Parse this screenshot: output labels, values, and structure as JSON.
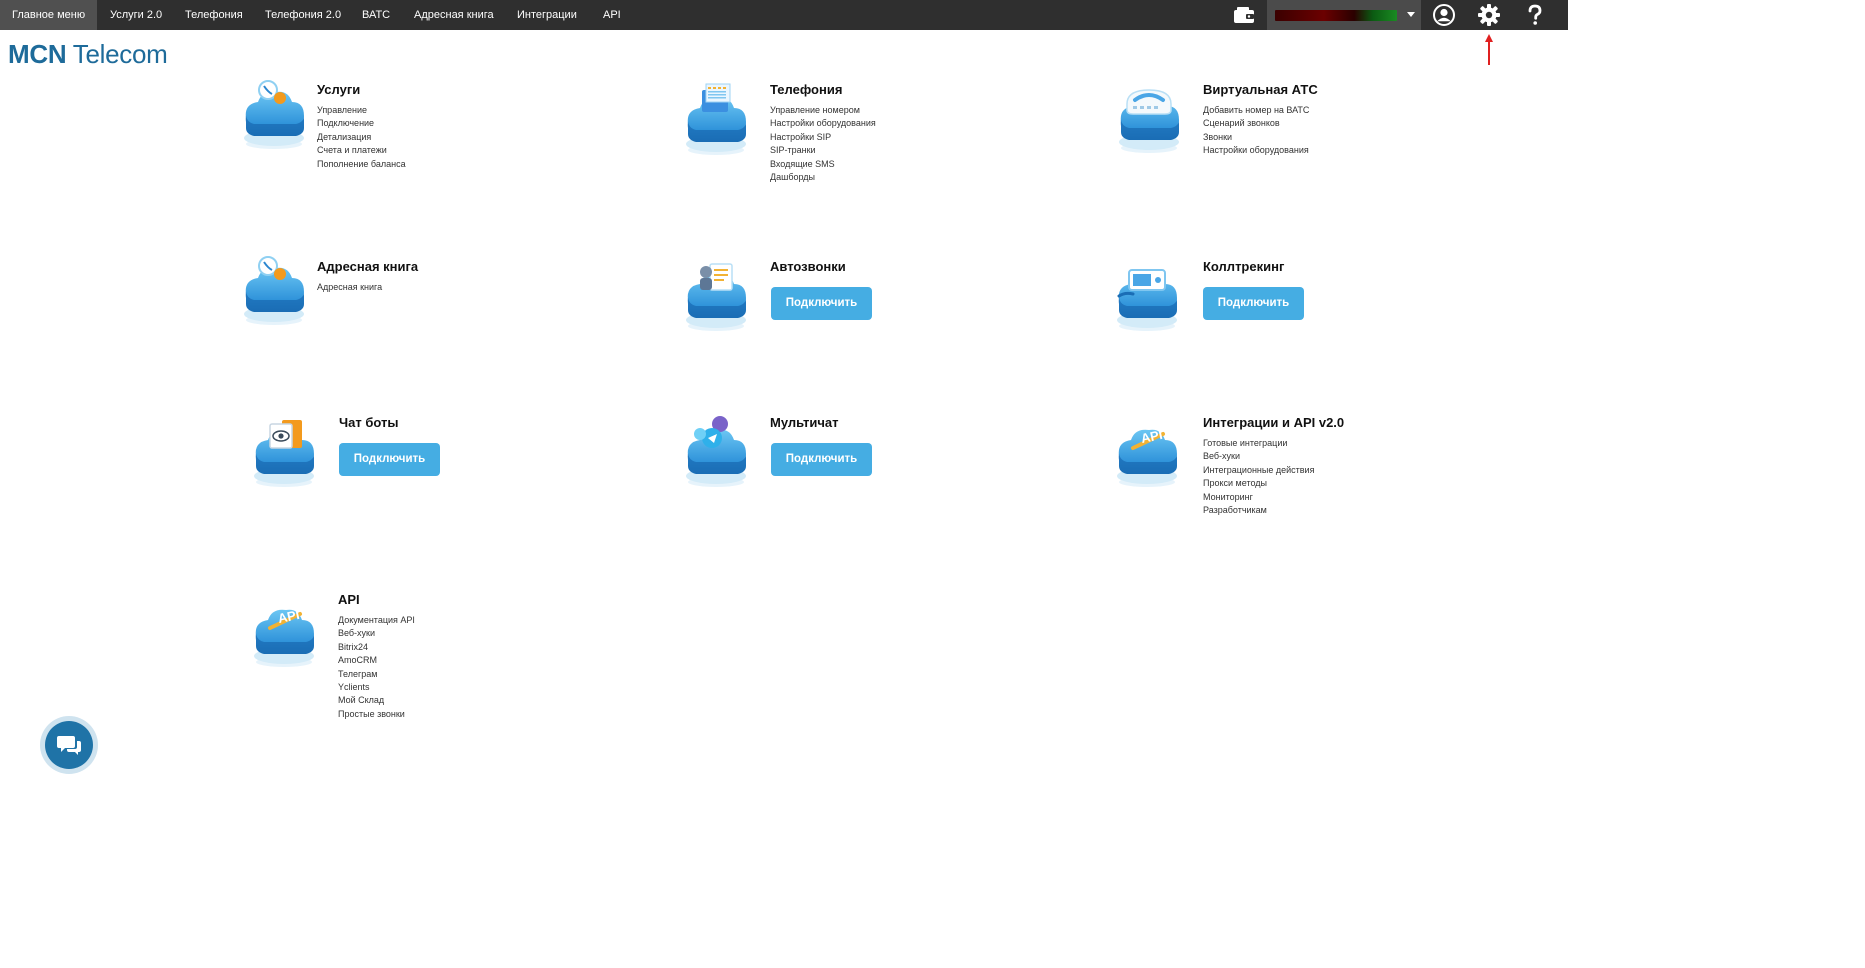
{
  "nav": {
    "items": [
      {
        "label": "Главное меню",
        "active": true
      },
      {
        "label": "Услуги 2.0"
      },
      {
        "label": "Телефония"
      },
      {
        "label": "Телефония 2.0"
      },
      {
        "label": "ВАТС"
      },
      {
        "label": "Адресная книга"
      },
      {
        "label": "Интеграции"
      },
      {
        "label": "API"
      }
    ],
    "icons": [
      "wallet-icon",
      "user-circle-icon",
      "gear-icon",
      "help-icon"
    ]
  },
  "logo": {
    "bold": "MCN",
    "rest": " Telecom"
  },
  "cards": {
    "uslugi": {
      "title": "Услуги",
      "links": [
        "Управление",
        "Подключение",
        "Детализация",
        "Счета и платежи",
        "Пополнение баланса"
      ]
    },
    "telefoniya": {
      "title": "Телефония",
      "links": [
        "Управление номером",
        "Настройки оборудования",
        "Настройки SIP",
        "SIP-транки",
        "Входящие SMS",
        "Дашборды"
      ]
    },
    "vats": {
      "title": "Виртуальная АТС",
      "links": [
        "Добавить номер на ВАТС",
        "Сценарий звонков",
        "Звонки",
        "Настройки оборудования"
      ]
    },
    "adresnaya": {
      "title": "Адресная книга",
      "links": [
        "Адресная книга"
      ]
    },
    "avtozvonki": {
      "title": "Автозвонки",
      "button": "Подключить"
    },
    "kolltreking": {
      "title": "Коллтрекинг",
      "button": "Подключить"
    },
    "chatboty": {
      "title": "Чат боты",
      "button": "Подключить"
    },
    "multichat": {
      "title": "Мультичат",
      "button": "Подключить"
    },
    "integracii": {
      "title": "Интеграции и API v2.0",
      "links": [
        "Готовые интеграции",
        "Веб-хуки",
        "Интеграционные действия",
        "Прокси методы",
        "Мониторинг",
        "Разработчикам"
      ]
    },
    "api": {
      "title": "API",
      "links": [
        "Документация API",
        "Веб-хуки",
        "Bitrix24",
        "AmoCRM",
        "Телеграм",
        "Yclients",
        "Мой Склад",
        "Простые звонки"
      ]
    }
  },
  "colors": {
    "topbar": "#2f2f2f",
    "active_tab": "#505050",
    "button": "#45ade3",
    "brand": "#1e6b9a",
    "annotation_arrow": "#e02020"
  }
}
